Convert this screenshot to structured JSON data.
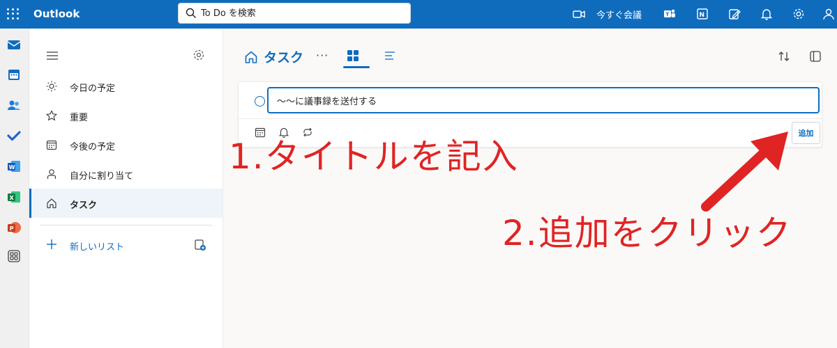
{
  "header": {
    "brand": "Outlook",
    "search_placeholder": "To Do を検索",
    "meet_now_label": "今すぐ会議",
    "accent_color": "#0f6cbd"
  },
  "rail": {
    "icons": [
      "mail-icon",
      "calendar-icon",
      "people-icon",
      "todo-icon",
      "word-icon",
      "excel-icon",
      "powerpoint-icon",
      "more-apps-icon"
    ]
  },
  "nav": {
    "items": [
      {
        "label": "今日の予定",
        "icon": "sun-icon"
      },
      {
        "label": "重要",
        "icon": "star-icon"
      },
      {
        "label": "今後の予定",
        "icon": "calendar-icon"
      },
      {
        "label": "自分に割り当て",
        "icon": "person-icon"
      },
      {
        "label": "タスク",
        "icon": "home-icon",
        "active": true
      }
    ],
    "new_list_label": "新しいリスト"
  },
  "main": {
    "list_title": "タスク",
    "more_label": "···",
    "task_input_value": "〜〜に議事録を送付する",
    "add_button_label": "追加"
  },
  "annotations": {
    "step1": "1.タイトルを記入",
    "step2": "2.追加をクリック",
    "color": "#e02424"
  }
}
